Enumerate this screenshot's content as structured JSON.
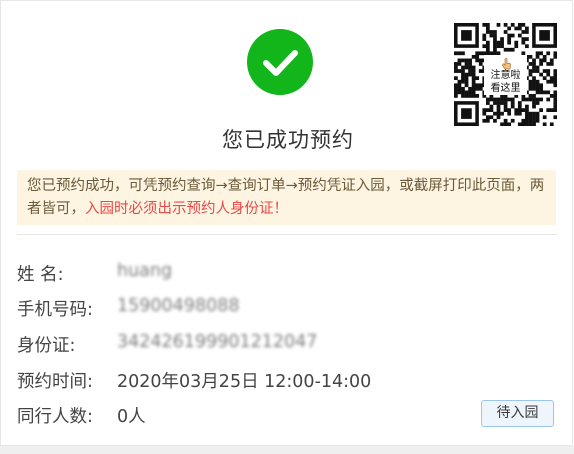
{
  "icons": {
    "status": "check-circle-icon",
    "qr": "qr-code-icon",
    "pointer": "hand-pointer-icon"
  },
  "colors": {
    "success": "#12b61b",
    "notice_bg": "#fdf4e1",
    "warning": "#e84a4a",
    "button_border": "#9cc6ec"
  },
  "qr_code": {
    "label_line1": "注意啦",
    "label_line2": "看这里"
  },
  "title": "您已成功预约",
  "notice": {
    "text": "您已预约成功，可凭预约查询→查询订单→预约凭证入园，或截屏打印此页面，两者皆可，",
    "warning": "入园时必须出示预约人身份证！"
  },
  "details": {
    "name": {
      "label": "姓  名:",
      "value": "huang"
    },
    "phone": {
      "label": "手机号码:",
      "value": "15900498088"
    },
    "id_card": {
      "label": "身份证:",
      "value": "342426199901212047"
    },
    "time": {
      "label": "预约时间:",
      "value": "2020年03月25日 12:00-14:00"
    },
    "companions": {
      "label": "同行人数:",
      "value": "0人"
    }
  },
  "button": {
    "label": "待入园"
  }
}
